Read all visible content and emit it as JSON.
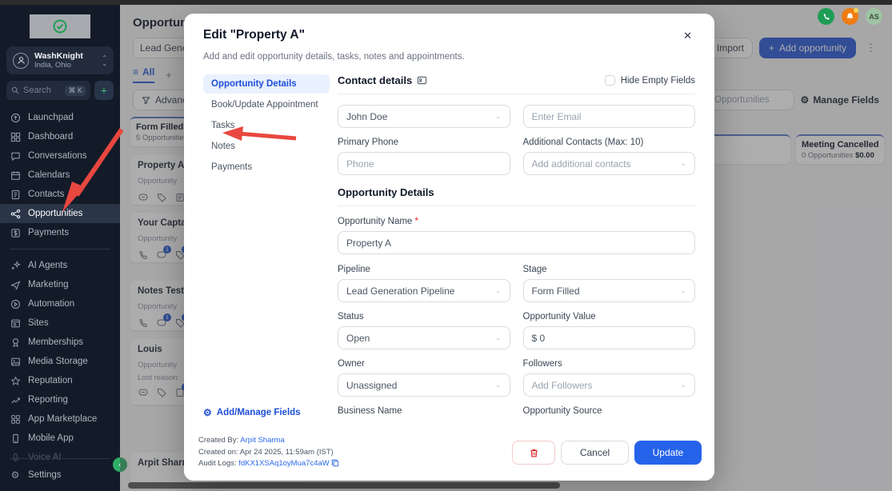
{
  "colors": {
    "accent": "#2563eb",
    "sidebar_bg": "#131b28",
    "arrow_red": "#e8473f",
    "phone_green": "#1f9d55",
    "bell_orange": "#ee7c12",
    "tab_active_blue": "#1d4fd8"
  },
  "sidebar": {
    "account": {
      "name": "WashKnight",
      "location": "India, Ohio"
    },
    "search": {
      "placeholder": "Search",
      "shortcut": "⌘ K",
      "add_label": "+"
    },
    "nav_primary": [
      {
        "label": "Launchpad"
      },
      {
        "label": "Dashboard"
      },
      {
        "label": "Conversations"
      },
      {
        "label": "Calendars"
      },
      {
        "label": "Contacts"
      },
      {
        "label": "Opportunities"
      },
      {
        "label": "Payments"
      }
    ],
    "nav_secondary": [
      {
        "label": "AI Agents"
      },
      {
        "label": "Marketing"
      },
      {
        "label": "Automation"
      },
      {
        "label": "Sites"
      },
      {
        "label": "Memberships"
      },
      {
        "label": "Media Storage"
      },
      {
        "label": "Reputation"
      },
      {
        "label": "Reporting"
      },
      {
        "label": "App Marketplace"
      },
      {
        "label": "Mobile App"
      },
      {
        "label": "Voice AI"
      }
    ],
    "settings_label": "Settings"
  },
  "header": {
    "avatar_initials": "AS"
  },
  "page": {
    "title": "Opportunities",
    "pipeline_select": "Lead Generation Pipeline",
    "import_label": "Import",
    "add_opportunity_label": "Add opportunity",
    "tab_all": "All",
    "tab_add": "+",
    "advanced_filters": "Advanced Filters",
    "search_placeholder": "Search Opportunities",
    "manage_fields": "Manage Fields",
    "columns": [
      {
        "name": "Form Filled",
        "meta": "5 Opportunities"
      },
      {
        "name": "Meeting Cancelled",
        "meta": "0 Opportunities",
        "value": "$0.00"
      }
    ],
    "cards": [
      {
        "title": "Property A",
        "line": "Opportunity"
      },
      {
        "title": "Your Captain",
        "line": "Opportunity",
        "badge1": "1",
        "badge2": "1"
      },
      {
        "title": "Notes Test",
        "line": "Opportunity",
        "badge1": "1",
        "badge2": "1"
      },
      {
        "title": "Louis",
        "line": "Opportunity",
        "line2": "Lost reason:",
        "badge1": "2"
      },
      {
        "title": "Arpit Sharma"
      }
    ]
  },
  "modal": {
    "title": "Edit \"Property A\"",
    "close": "✕",
    "subtitle": "Add and edit opportunity details, tasks, notes and appointments.",
    "tabs": [
      {
        "label": "Opportunity Details"
      },
      {
        "label": "Book/Update Appointment"
      },
      {
        "label": "Tasks"
      },
      {
        "label": "Notes"
      },
      {
        "label": "Payments"
      }
    ],
    "add_manage_fields": "Add/Manage Fields",
    "contact_section": "Contact details",
    "hide_empty_fields": "Hide Empty Fields",
    "fields": {
      "contact_name_value": "John Doe",
      "email_placeholder": "Enter Email",
      "primary_phone_label": "Primary Phone",
      "phone_placeholder": "Phone",
      "additional_contacts_label": "Additional Contacts (Max: 10)",
      "additional_contacts_placeholder": "Add additional contacts",
      "opportunity_section": "Opportunity Details",
      "opportunity_name_label": "Opportunity Name",
      "required_mark": "*",
      "opportunity_name_value": "Property A",
      "pipeline_label": "Pipeline",
      "pipeline_value": "Lead Generation Pipeline",
      "stage_label": "Stage",
      "stage_value": "Form Filled",
      "status_label": "Status",
      "status_value": "Open",
      "value_label": "Opportunity Value",
      "value_value": "$ 0",
      "owner_label": "Owner",
      "owner_value": "Unassigned",
      "followers_label": "Followers",
      "followers_placeholder": "Add Followers",
      "business_name_label": "Business Name",
      "source_label": "Opportunity Source"
    },
    "footer": {
      "created_by_label": "Created By:",
      "created_by_value": "Arpit Sharma",
      "created_on": "Created on: Apr 24 2025, 11:59am (IST)",
      "audit_label": "Audit Logs:",
      "audit_value": "fdKX1XSAq1oyMua7c4aW",
      "cancel_label": "Cancel",
      "update_label": "Update"
    }
  }
}
